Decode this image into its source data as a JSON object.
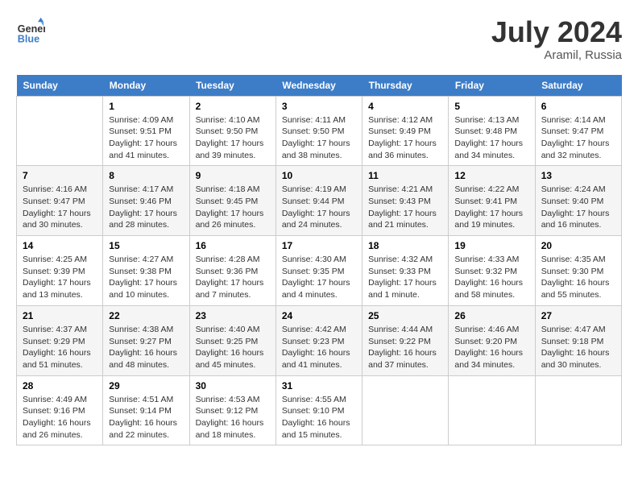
{
  "header": {
    "logo_line1": "General",
    "logo_line2": "Blue",
    "month_year": "July 2024",
    "location": "Aramil, Russia"
  },
  "weekdays": [
    "Sunday",
    "Monday",
    "Tuesday",
    "Wednesday",
    "Thursday",
    "Friday",
    "Saturday"
  ],
  "weeks": [
    [
      {
        "day": null,
        "info": null
      },
      {
        "day": "1",
        "info": "Sunrise: 4:09 AM\nSunset: 9:51 PM\nDaylight: 17 hours\nand 41 minutes."
      },
      {
        "day": "2",
        "info": "Sunrise: 4:10 AM\nSunset: 9:50 PM\nDaylight: 17 hours\nand 39 minutes."
      },
      {
        "day": "3",
        "info": "Sunrise: 4:11 AM\nSunset: 9:50 PM\nDaylight: 17 hours\nand 38 minutes."
      },
      {
        "day": "4",
        "info": "Sunrise: 4:12 AM\nSunset: 9:49 PM\nDaylight: 17 hours\nand 36 minutes."
      },
      {
        "day": "5",
        "info": "Sunrise: 4:13 AM\nSunset: 9:48 PM\nDaylight: 17 hours\nand 34 minutes."
      },
      {
        "day": "6",
        "info": "Sunrise: 4:14 AM\nSunset: 9:47 PM\nDaylight: 17 hours\nand 32 minutes."
      }
    ],
    [
      {
        "day": "7",
        "info": "Sunrise: 4:16 AM\nSunset: 9:47 PM\nDaylight: 17 hours\nand 30 minutes."
      },
      {
        "day": "8",
        "info": "Sunrise: 4:17 AM\nSunset: 9:46 PM\nDaylight: 17 hours\nand 28 minutes."
      },
      {
        "day": "9",
        "info": "Sunrise: 4:18 AM\nSunset: 9:45 PM\nDaylight: 17 hours\nand 26 minutes."
      },
      {
        "day": "10",
        "info": "Sunrise: 4:19 AM\nSunset: 9:44 PM\nDaylight: 17 hours\nand 24 minutes."
      },
      {
        "day": "11",
        "info": "Sunrise: 4:21 AM\nSunset: 9:43 PM\nDaylight: 17 hours\nand 21 minutes."
      },
      {
        "day": "12",
        "info": "Sunrise: 4:22 AM\nSunset: 9:41 PM\nDaylight: 17 hours\nand 19 minutes."
      },
      {
        "day": "13",
        "info": "Sunrise: 4:24 AM\nSunset: 9:40 PM\nDaylight: 17 hours\nand 16 minutes."
      }
    ],
    [
      {
        "day": "14",
        "info": "Sunrise: 4:25 AM\nSunset: 9:39 PM\nDaylight: 17 hours\nand 13 minutes."
      },
      {
        "day": "15",
        "info": "Sunrise: 4:27 AM\nSunset: 9:38 PM\nDaylight: 17 hours\nand 10 minutes."
      },
      {
        "day": "16",
        "info": "Sunrise: 4:28 AM\nSunset: 9:36 PM\nDaylight: 17 hours\nand 7 minutes."
      },
      {
        "day": "17",
        "info": "Sunrise: 4:30 AM\nSunset: 9:35 PM\nDaylight: 17 hours\nand 4 minutes."
      },
      {
        "day": "18",
        "info": "Sunrise: 4:32 AM\nSunset: 9:33 PM\nDaylight: 17 hours\nand 1 minute."
      },
      {
        "day": "19",
        "info": "Sunrise: 4:33 AM\nSunset: 9:32 PM\nDaylight: 16 hours\nand 58 minutes."
      },
      {
        "day": "20",
        "info": "Sunrise: 4:35 AM\nSunset: 9:30 PM\nDaylight: 16 hours\nand 55 minutes."
      }
    ],
    [
      {
        "day": "21",
        "info": "Sunrise: 4:37 AM\nSunset: 9:29 PM\nDaylight: 16 hours\nand 51 minutes."
      },
      {
        "day": "22",
        "info": "Sunrise: 4:38 AM\nSunset: 9:27 PM\nDaylight: 16 hours\nand 48 minutes."
      },
      {
        "day": "23",
        "info": "Sunrise: 4:40 AM\nSunset: 9:25 PM\nDaylight: 16 hours\nand 45 minutes."
      },
      {
        "day": "24",
        "info": "Sunrise: 4:42 AM\nSunset: 9:23 PM\nDaylight: 16 hours\nand 41 minutes."
      },
      {
        "day": "25",
        "info": "Sunrise: 4:44 AM\nSunset: 9:22 PM\nDaylight: 16 hours\nand 37 minutes."
      },
      {
        "day": "26",
        "info": "Sunrise: 4:46 AM\nSunset: 9:20 PM\nDaylight: 16 hours\nand 34 minutes."
      },
      {
        "day": "27",
        "info": "Sunrise: 4:47 AM\nSunset: 9:18 PM\nDaylight: 16 hours\nand 30 minutes."
      }
    ],
    [
      {
        "day": "28",
        "info": "Sunrise: 4:49 AM\nSunset: 9:16 PM\nDaylight: 16 hours\nand 26 minutes."
      },
      {
        "day": "29",
        "info": "Sunrise: 4:51 AM\nSunset: 9:14 PM\nDaylight: 16 hours\nand 22 minutes."
      },
      {
        "day": "30",
        "info": "Sunrise: 4:53 AM\nSunset: 9:12 PM\nDaylight: 16 hours\nand 18 minutes."
      },
      {
        "day": "31",
        "info": "Sunrise: 4:55 AM\nSunset: 9:10 PM\nDaylight: 16 hours\nand 15 minutes."
      },
      {
        "day": null,
        "info": null
      },
      {
        "day": null,
        "info": null
      },
      {
        "day": null,
        "info": null
      }
    ]
  ]
}
